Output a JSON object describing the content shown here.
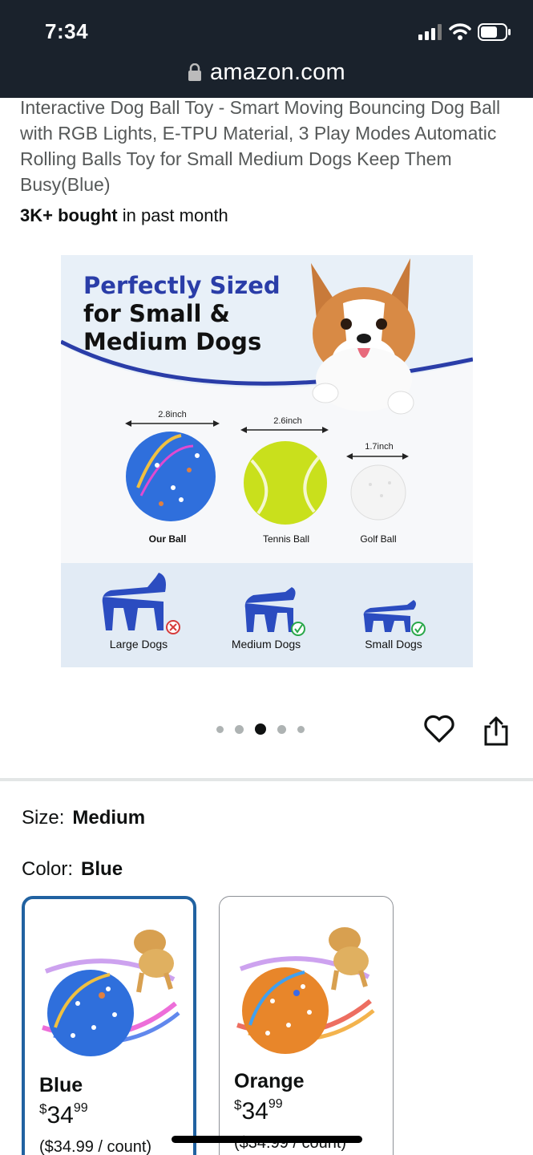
{
  "status": {
    "time": "7:34"
  },
  "browser": {
    "url": "amazon.com"
  },
  "product": {
    "title": "Interactive Dog Ball Toy - Smart Moving Bouncing Dog Ball with RGB Lights, E-TPU Material, 3 Play Modes Automatic Rolling Balls Toy for Small Medium Dogs Keep Them Busy(Blue)",
    "bought_bold": "3K+ bought",
    "bought_rest": " in past month"
  },
  "hero_image": {
    "headline_line1": "Perfectly Sized",
    "headline_line2": "for Small &",
    "headline_line3": "Medium Dogs",
    "balls": [
      {
        "size": "2.8inch",
        "label": "Our Ball"
      },
      {
        "size": "2.6inch",
        "label": "Tennis Ball"
      },
      {
        "size": "1.7inch",
        "label": "Golf Ball"
      }
    ],
    "dogs": [
      {
        "label": "Large Dogs",
        "fit": "no"
      },
      {
        "label": "Medium Dogs",
        "fit": "yes"
      },
      {
        "label": "Small Dogs",
        "fit": "yes"
      }
    ],
    "colors": {
      "blue": "#2b4cc0",
      "panel": "#e6eef6",
      "check": "#2aa84a",
      "cross": "#d63b3b"
    }
  },
  "carousel": {
    "count": 5,
    "active": 3
  },
  "options": {
    "size_label": "Size:",
    "size_value": "Medium",
    "color_label": "Color:",
    "color_value": "Blue"
  },
  "swatches": [
    {
      "name": "Blue",
      "currency": "$",
      "whole": "34",
      "fraction": "99",
      "unit_price": "($34.99 / count)",
      "selected": true
    },
    {
      "name": "Orange",
      "currency": "$",
      "whole": "34",
      "fraction": "99",
      "unit_price": "($34.99 / count)",
      "selected": false
    }
  ],
  "icons": [
    "signal-icon",
    "wifi-icon",
    "battery-icon",
    "lock-icon",
    "heart-icon",
    "share-icon"
  ]
}
